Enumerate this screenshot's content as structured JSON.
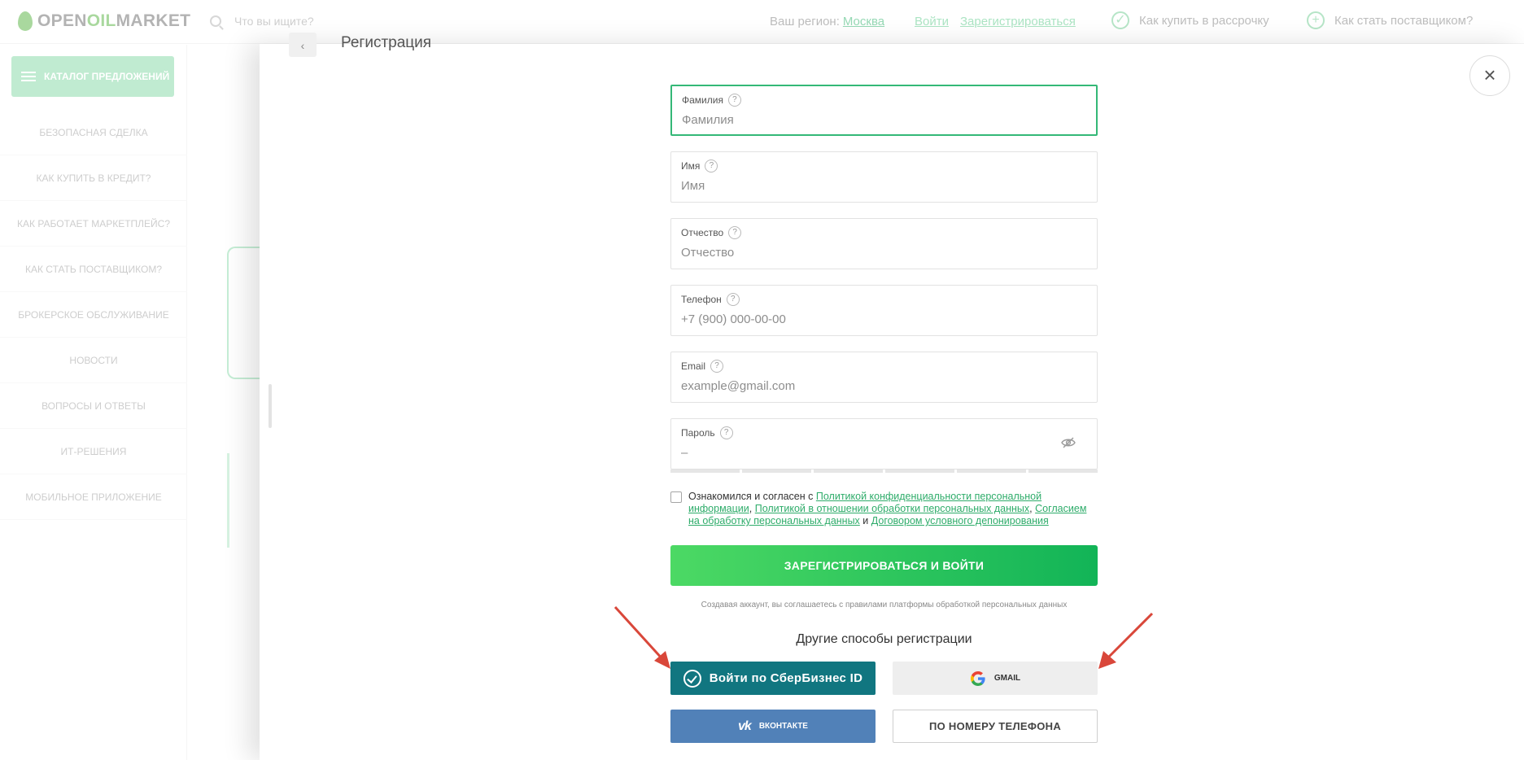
{
  "header": {
    "logo_open": "OPEN",
    "logo_oil": "OIL",
    "logo_market": "MARKET",
    "search_placeholder": "Что вы ищите?",
    "region_label": "Ваш регион:",
    "region_value": "Москва",
    "login_link": "Войти",
    "register_link": "Зарегистрироваться",
    "nav_installments": "Как купить в рассрочку",
    "nav_supplier": "Как стать поставщиком?"
  },
  "sidebar": {
    "catalog_button": "КАТАЛОГ ПРЕДЛОЖЕНИЙ",
    "items": [
      {
        "label": "БЕЗОПАСНАЯ СДЕЛКА"
      },
      {
        "label": "КАК КУПИТЬ В КРЕДИТ?"
      },
      {
        "label": "КАК РАБОТАЕТ МАРКЕТПЛЕЙС?"
      },
      {
        "label": "КАК СТАТЬ ПОСТАВЩИКОМ?"
      },
      {
        "label": "БРОКЕРСКОЕ ОБСЛУЖИВАНИЕ"
      },
      {
        "label": "НОВОСТИ"
      },
      {
        "label": "ВОПРОСЫ И ОТВЕТЫ"
      },
      {
        "label": "ИТ-РЕШЕНИЯ"
      },
      {
        "label": "МОБИЛЬНОЕ ПРИЛОЖЕНИЕ"
      }
    ]
  },
  "modal": {
    "title": "Регистрация",
    "fields": {
      "lastname": {
        "label": "Фамилия",
        "placeholder": "Фамилия",
        "value": ""
      },
      "firstname": {
        "label": "Имя",
        "placeholder": "Имя",
        "value": ""
      },
      "patronymic": {
        "label": "Отчество",
        "placeholder": "Отчество",
        "value": ""
      },
      "phone": {
        "label": "Телефон",
        "placeholder": "+7 (900) 000-00-00",
        "value": ""
      },
      "email": {
        "label": "Email",
        "placeholder": "example@gmail.com",
        "value": ""
      },
      "password": {
        "label": "Пароль",
        "placeholder": "–",
        "value": ""
      }
    },
    "consent": {
      "prefix": "Ознакомился и согласен с",
      "link_privacy": "Политикой конфиденциальности персональной информации",
      "sep1": ",",
      "link_processing": "Политикой в отношении обработки персональных данных",
      "sep2": ",",
      "link_agreement": "Согласием на обработку персональных данных",
      "and": "и",
      "link_deposit": "Договором условного депонирования"
    },
    "submit_label": "ЗАРЕГИСТРИРОВАТЬСЯ И ВОЙТИ",
    "note": "Создавая аккаунт, вы соглашаетесь с правилами платформы обработкой персональных данных",
    "other_title": "Другие способы регистрации",
    "sber_label": "Войти по СберБизнес ID",
    "gmail_label": "GMAIL",
    "vk_label": "ВКОНТАКТЕ",
    "phone_label": "ПО НОМЕРУ ТЕЛЕФОНА"
  },
  "colors": {
    "brand_green": "#34b877",
    "sber_teal": "#117680",
    "vk_blue": "#5181b8",
    "annotation_red": "#d9473a"
  }
}
